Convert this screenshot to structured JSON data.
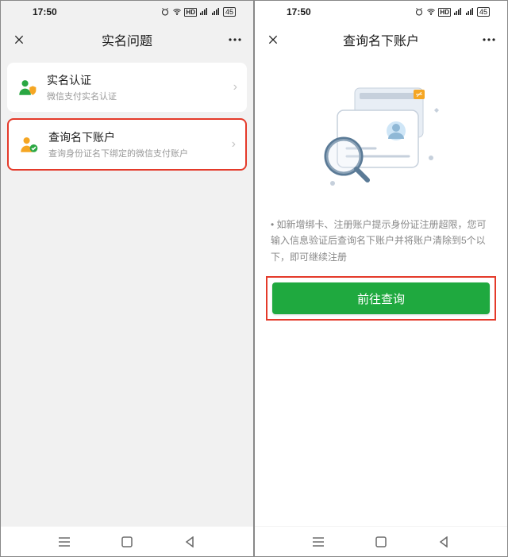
{
  "status": {
    "time": "17:50",
    "battery": "45"
  },
  "left": {
    "title": "实名问题",
    "items": [
      {
        "title": "实名认证",
        "subtitle": "微信支付实名认证"
      },
      {
        "title": "查询名下账户",
        "subtitle": "查询身份证名下绑定的微信支付账户"
      }
    ]
  },
  "right": {
    "title": "查询名下账户",
    "info_bullet": "•",
    "info_text": "如新增绑卡、注册账户提示身份证注册超限，您可输入信息验证后查询名下账户并将账户清除到5个以下，即可继续注册",
    "cta": "前往查询"
  }
}
